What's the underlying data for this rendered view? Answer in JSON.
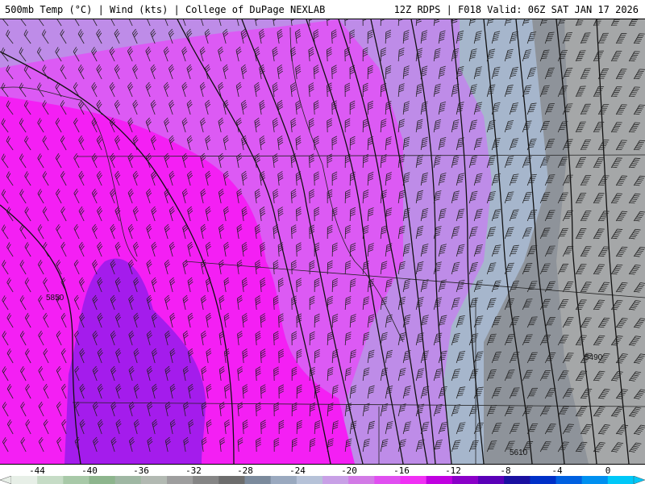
{
  "header": {
    "left": "500mb Temp (°C) | Wind (kts) | College of DuPage NEXLAB",
    "right": "12Z RDPS | F018 Valid: 06Z SAT JAN 17 2026"
  },
  "map": {
    "contour_labels": [
      "5850",
      "5490",
      "5610"
    ]
  },
  "legend": {
    "ticks": [
      "-44",
      "-40",
      "-36",
      "-32",
      "-28",
      "-24",
      "-20",
      "-16",
      "-12",
      "-8",
      "-4",
      "0"
    ],
    "colors": [
      "#e7efe7",
      "#c6dcc6",
      "#a8c9a8",
      "#8db58d",
      "#9fb7a3",
      "#b2b9b2",
      "#9e9e9e",
      "#858585",
      "#6d6d6d",
      "#7b8a9c",
      "#9aa9bf",
      "#b6c2d8",
      "#c8a0e6",
      "#d27ae6",
      "#e04ff0",
      "#f030f4",
      "#c000e0",
      "#8a00c8",
      "#5a00b8",
      "#1a10a0",
      "#0030c8",
      "#0060e0",
      "#0090f0",
      "#00c8f8"
    ]
  },
  "colors": {
    "temp_pink": "#f41ff4",
    "temp_magenta": "#dc5af4",
    "temp_lavender": "#be8ce8",
    "temp_purple": "#9f23ec",
    "temp_blue_gray": "#a6b6cc",
    "temp_gray": "#8e939a"
  }
}
